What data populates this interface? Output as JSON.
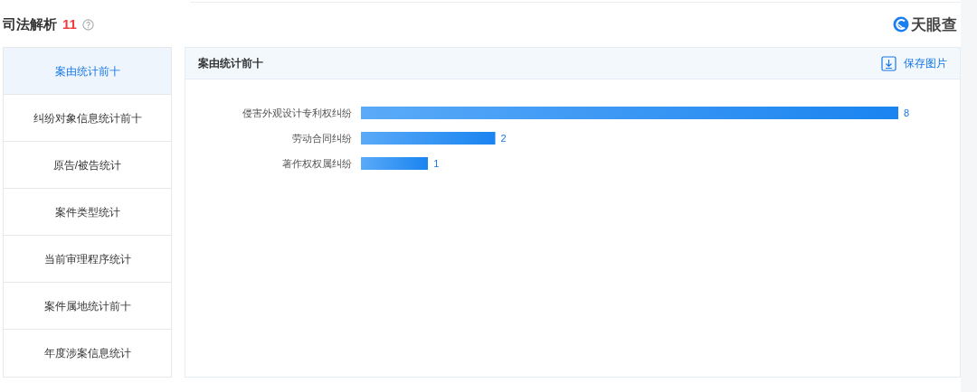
{
  "section": {
    "title": "司法解析",
    "count": "11",
    "logo": "天眼查"
  },
  "sidebar": {
    "items": [
      {
        "label": "案由统计前十",
        "selected": true
      },
      {
        "label": "纠纷对象信息统计前十",
        "selected": false
      },
      {
        "label": "原告/被告统计",
        "selected": false
      },
      {
        "label": "案件类型统计",
        "selected": false
      },
      {
        "label": "当前审理程序统计",
        "selected": false
      },
      {
        "label": "案件属地统计前十",
        "selected": false
      },
      {
        "label": "年度涉案信息统计",
        "selected": false
      }
    ]
  },
  "panel": {
    "title": "案由统计前十",
    "save_button": "保存图片",
    "chart_data": {
      "type": "bar",
      "orientation": "horizontal",
      "data_labels": true,
      "xlim": [
        0,
        8
      ],
      "categories": [
        "侵害外观设计专利权纠纷",
        "劳动合同纠纷",
        "著作权权属纠纷"
      ],
      "values": [
        8,
        2,
        1
      ]
    }
  }
}
